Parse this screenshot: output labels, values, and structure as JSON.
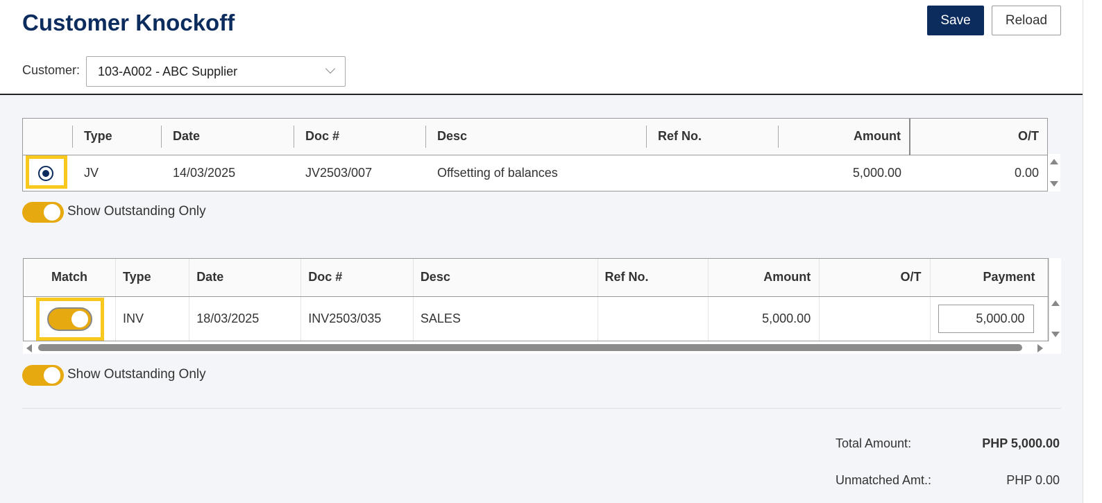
{
  "header": {
    "title": "Customer Knockoff",
    "save_label": "Save",
    "reload_label": "Reload",
    "customer_label": "Customer:",
    "customer_value": "103-A002 - ABC Supplier"
  },
  "top_grid": {
    "columns": [
      "",
      "Type",
      "Date",
      "Doc #",
      "Desc",
      "Ref No.",
      "Amount",
      "O/T"
    ],
    "rows": [
      {
        "selected": true,
        "type": "JV",
        "date": "14/03/2025",
        "doc": "JV2503/007",
        "desc": "Offsetting of balances",
        "ref": "",
        "amount": "5,000.00",
        "ot": "0.00"
      }
    ],
    "show_outstanding_label": "Show Outstanding Only",
    "show_outstanding_on": true
  },
  "bottom_grid": {
    "columns": [
      "Match",
      "Type",
      "Date",
      "Doc #",
      "Desc",
      "Ref No.",
      "Amount",
      "O/T",
      "Payment"
    ],
    "rows": [
      {
        "match": true,
        "type": "INV",
        "date": "18/03/2025",
        "doc": "INV2503/035",
        "desc": "SALES",
        "ref": "",
        "amount": "5,000.00",
        "ot": "",
        "payment": "5,000.00"
      }
    ],
    "show_outstanding_label": "Show Outstanding Only",
    "show_outstanding_on": true
  },
  "summary": {
    "total_label": "Total Amount:",
    "total_value": "PHP 5,000.00",
    "unmatched_label": "Unmatched Amt.:",
    "unmatched_value": "PHP 0.00"
  },
  "colors": {
    "brand": "#0c2c5e",
    "toggle_on": "#e6a90f",
    "highlight": "#f8c81e",
    "link": "#1ca9e6"
  }
}
